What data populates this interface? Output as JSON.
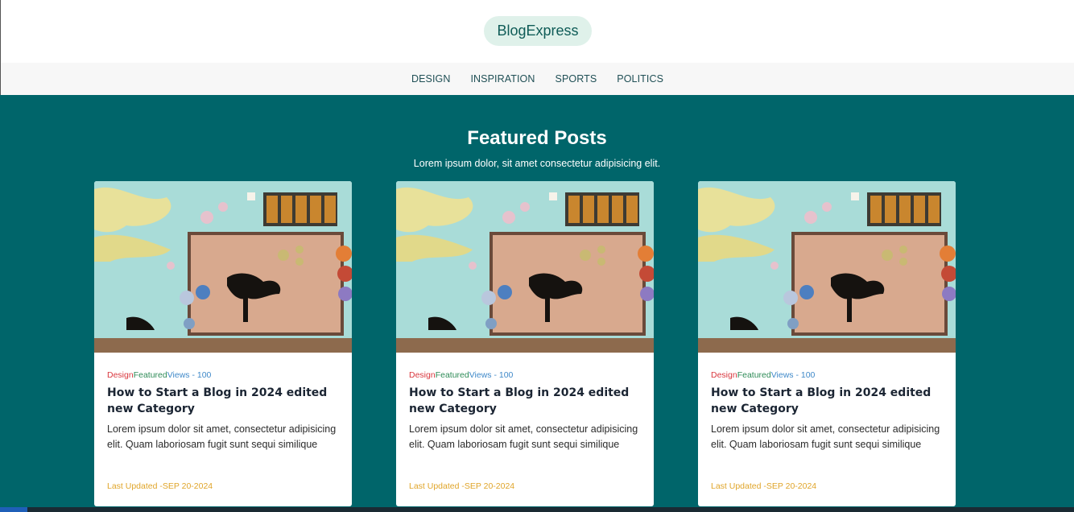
{
  "header": {
    "brand": "BlogExpress"
  },
  "nav": {
    "items": [
      "DESIGN",
      "INSPIRATION",
      "SPORTS",
      "POLITICS"
    ]
  },
  "featured": {
    "title": "Featured Posts",
    "subtitle": "Lorem ipsum dolor, sit amet consectetur adipisicing elit."
  },
  "cards": [
    {
      "category": "Design",
      "tag": "Featured",
      "views": "Views - 100",
      "title": "How to Start a Blog in 2024 edited new Category",
      "excerpt": "Lorem ipsum dolor sit amet, consectetur adipisicing elit. Quam laboriosam fugit sunt sequi similique",
      "updated": "Last Updated -SEP 20-2024"
    },
    {
      "category": "Design",
      "tag": "Featured",
      "views": "Views - 100",
      "title": "How to Start a Blog in 2024 edited new Category",
      "excerpt": "Lorem ipsum dolor sit amet, consectetur adipisicing elit. Quam laboriosam fugit sunt sequi similique",
      "updated": "Last Updated -SEP 20-2024"
    },
    {
      "category": "Design",
      "tag": "Featured",
      "views": "Views - 100",
      "title": "How to Start a Blog in 2024 edited new Category",
      "excerpt": "Lorem ipsum dolor sit amet, consectetur adipisicing elit. Quam laboriosam fugit sunt sequi similique",
      "updated": "Last Updated -SEP 20-2024"
    }
  ],
  "colors": {
    "featured_bg": "#00656a",
    "brand_pill": "#dff1ea",
    "category": "#d9373e",
    "tag": "#2e8b57",
    "views": "#3f89c9",
    "updated": "#e0a52a"
  }
}
